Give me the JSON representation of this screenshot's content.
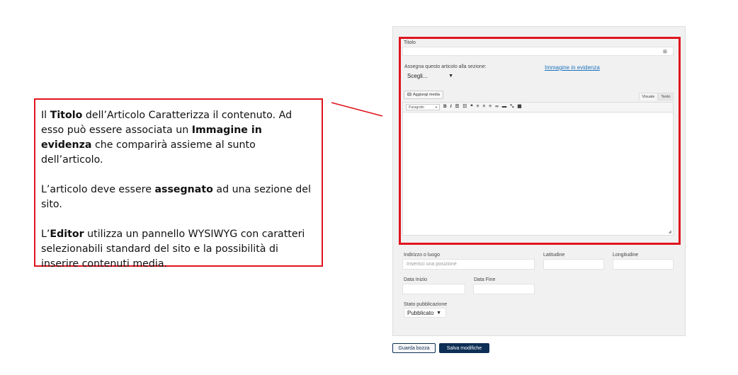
{
  "callout": {
    "p1_a": "Il ",
    "p1_b": "Titolo",
    "p1_c": " dell’Articolo Caratterizza il contenuto. Ad esso può essere associata un ",
    "p1_d": "Immagine in evidenza",
    "p1_e": " che comparirà assieme al sunto dell’articolo.",
    "p2_a": "L’articolo deve essere ",
    "p2_b": "assegnato",
    "p2_c": " ad una sezione del sito.",
    "p3_a": "L’",
    "p3_b": "Editor",
    "p3_c": " utilizza un pannello WYSIWYG con caratteri selezionabili standard del sito e la possibilità di inserire contenuti media."
  },
  "form": {
    "title_label": "Titolo",
    "title_value": "",
    "section_label": "Assegna questo articolo alla sezione:",
    "section_value": "Scegli...",
    "featured_image_link": "Immagine in evidenza",
    "add_media_label": "Aggiungi media",
    "tab_visual": "Visuale",
    "tab_text": "Testo",
    "format_select": "Paragrafo",
    "address_label": "Indirizzo o luogo",
    "address_placeholder": "Inserisci una posizione",
    "latitude_label": "Latitudine",
    "longitude_label": "Longitudine",
    "start_date_label": "Data Inizio",
    "end_date_label": "Data Fine",
    "status_label": "Stato pubblicazione",
    "status_value": "Pubblicato"
  },
  "actions": {
    "draft_label": "Guarda bozza",
    "save_label": "Salva modifiche"
  },
  "colors": {
    "highlight": "#e0141e",
    "primary_button": "#0e2f55",
    "link": "#1e73be"
  },
  "icons": {
    "toolbar": [
      "bold-icon",
      "italic-icon",
      "bullet-list-icon",
      "numbered-list-icon",
      "blockquote-icon",
      "align-left-icon",
      "align-center-icon",
      "align-right-icon",
      "link-icon",
      "horizontal-rule-icon",
      "fullscreen-icon",
      "toolbar-toggle-icon"
    ]
  }
}
